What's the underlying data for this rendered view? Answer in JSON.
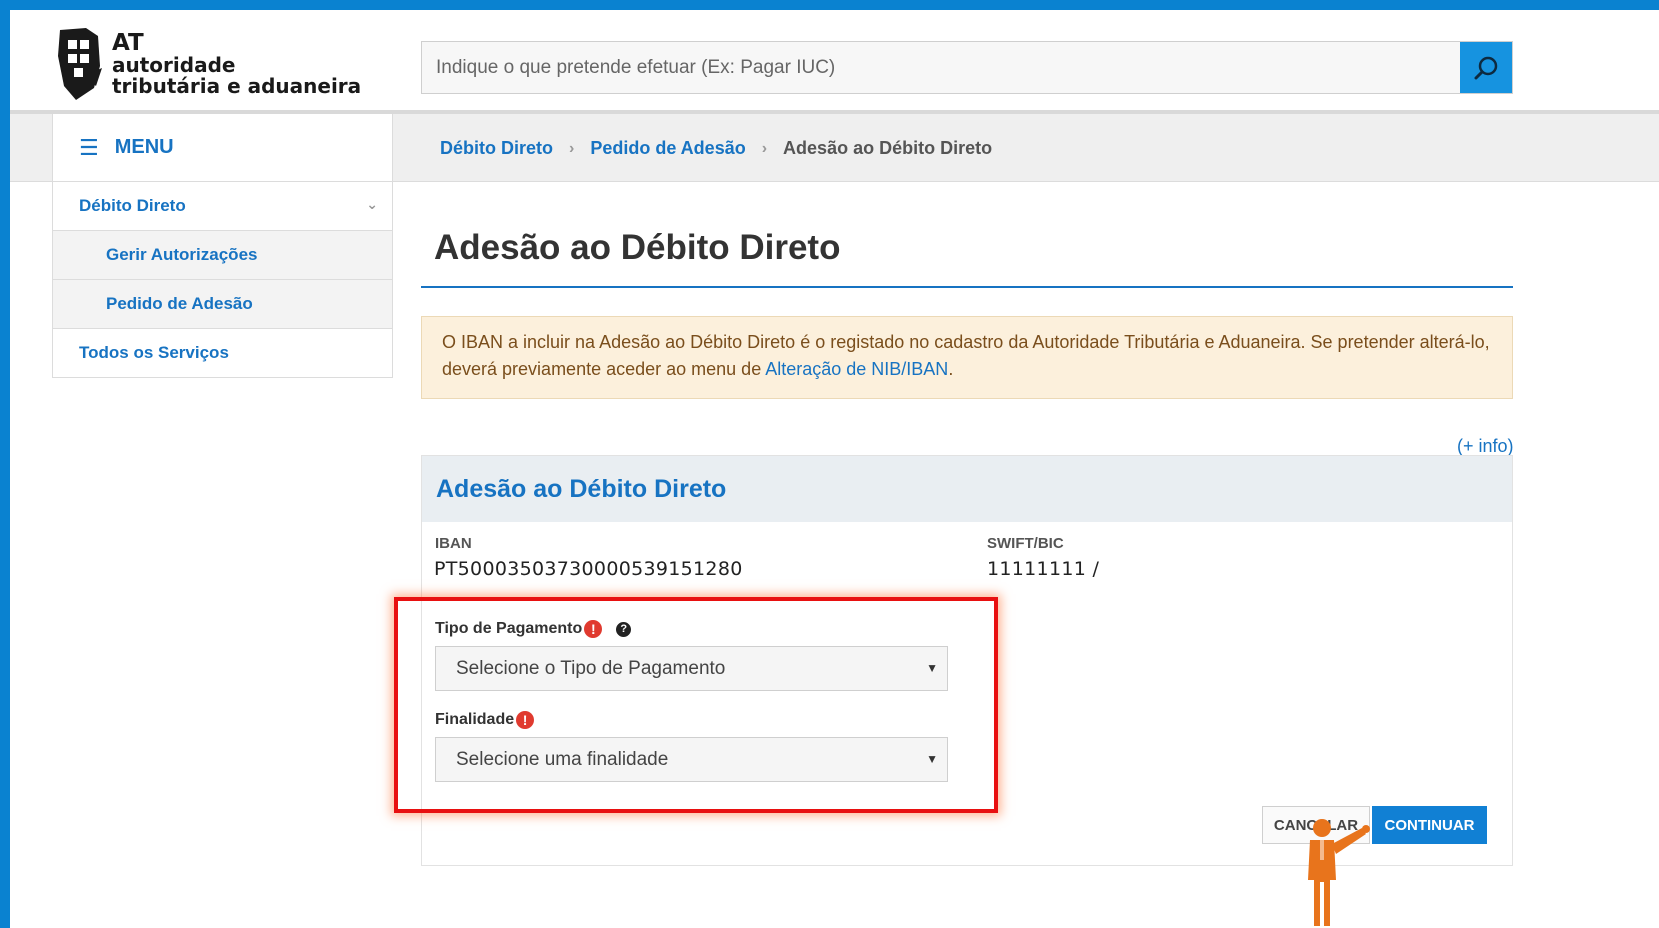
{
  "header": {
    "logo": {
      "line1": "AT",
      "line2": "autoridade",
      "line3": "tributária e aduaneira"
    },
    "search": {
      "placeholder": "Indique o que pretende efetuar (Ex: Pagar IUC)",
      "icon": "search-icon"
    }
  },
  "menu": {
    "label": "MENU",
    "icon": "hamburger-icon"
  },
  "breadcrumb": [
    "Débito Direto",
    "Pedido de Adesão",
    "Adesão ao Débito Direto"
  ],
  "sidebar": {
    "items": [
      {
        "label": "Débito Direto",
        "level": 1,
        "expanded": true
      },
      {
        "label": "Gerir Autorizações",
        "level": 2
      },
      {
        "label": "Pedido de Adesão",
        "level": 2
      },
      {
        "label": "Todos os Serviços",
        "level": 1
      }
    ]
  },
  "main": {
    "title": "Adesão ao Débito Direto",
    "alert": {
      "text": "O IBAN a incluir na Adesão ao Débito Direto é o registado no cadastro da Autoridade Tributária e Aduaneira. Se pretender alterá-lo, deverá previamente aceder ao menu de ",
      "link": "Alteração de NIB/IBAN",
      "suffix": "."
    },
    "info_link": "(+ info)",
    "panel": {
      "title": "Adesão ao Débito Direto",
      "iban_label": "IBAN",
      "iban_value": "PT50003503730000539151280",
      "swift_label": "SWIFT/BIC",
      "swift_value": "11111111 /",
      "tipo_label": "Tipo de Pagamento",
      "tipo_placeholder": "Selecione o Tipo de Pagamento",
      "finalidade_label": "Finalidade",
      "finalidade_placeholder": "Selecione uma finalidade",
      "required_mark": "!",
      "help_mark": "?",
      "cancel_label": "CANCELAR",
      "continue_label": "CONTINUAR"
    }
  },
  "colors": {
    "brand": "#1773c2",
    "accent": "#1693e0",
    "alert_bg": "#fcf0dc",
    "highlight": "#e81010",
    "figure": "#e8741c"
  }
}
